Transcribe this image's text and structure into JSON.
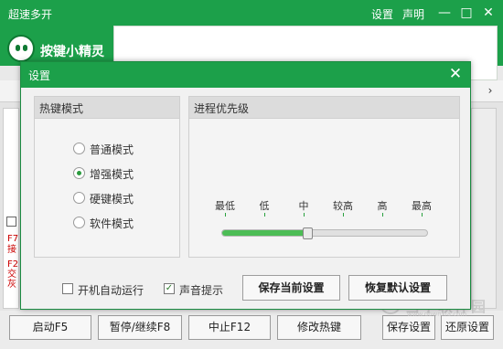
{
  "app": {
    "title": "超速多开",
    "logo_text": "按键小精灵",
    "menu": {
      "settings": "设置",
      "about": "声明"
    },
    "window_buttons": {
      "minimize": "—",
      "maximize": "□",
      "close": "✕"
    }
  },
  "tabstrip": {
    "arrow": "›"
  },
  "background_left": {
    "lines": [
      "F7",
      "接",
      "F2",
      "交",
      "灰"
    ]
  },
  "main_buttons": [
    {
      "label": "启动F5"
    },
    {
      "label": "暂停/继续F8"
    },
    {
      "label": "中止F12"
    },
    {
      "label": "修改热键"
    },
    {
      "label": "保存设置"
    },
    {
      "label": "还原设置"
    }
  ],
  "watermark": {
    "text": "当下软件园",
    "url": "www.downxia.com"
  },
  "dialog": {
    "title": "设置",
    "close": "✕",
    "hotkey_group": {
      "title": "热键模式",
      "options": [
        {
          "label": "普通模式",
          "selected": false
        },
        {
          "label": "增强模式",
          "selected": true
        },
        {
          "label": "硬键模式",
          "selected": false
        },
        {
          "label": "软件模式",
          "selected": false
        }
      ]
    },
    "priority_group": {
      "title": "进程优先级",
      "levels": [
        "最低",
        "低",
        "中",
        "较高",
        "高",
        "最高"
      ],
      "selected_index": 2
    },
    "checkboxes": [
      {
        "label": "开机自动运行",
        "checked": false
      },
      {
        "label": "声音提示",
        "checked": true
      }
    ],
    "buttons": {
      "save_current": "保存当前设置",
      "restore_default": "恢复默认设置"
    },
    "check_mark": "✓"
  },
  "colors": {
    "accent": "#1ca04a",
    "slider_fill": "#4cbd55"
  }
}
